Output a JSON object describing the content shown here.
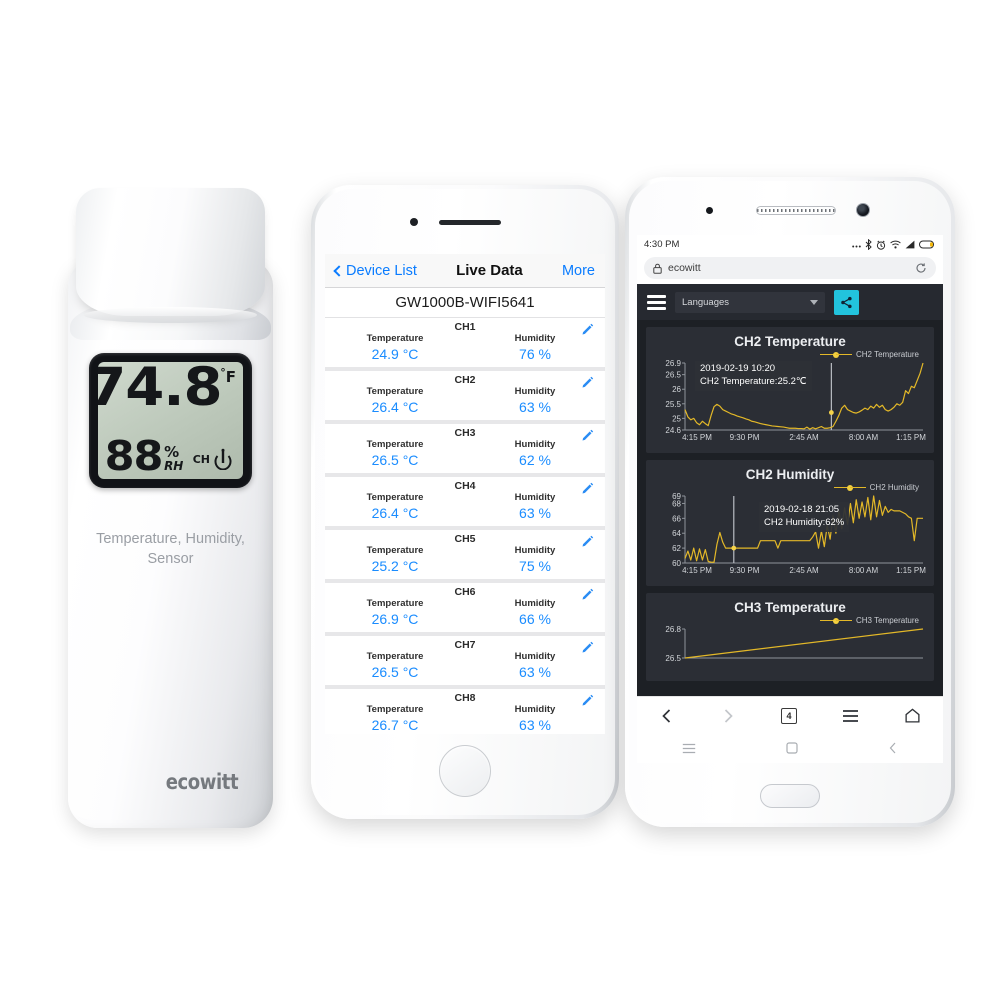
{
  "scene": {
    "background": "#ffffff"
  },
  "sensor": {
    "name": "ecowitt-temperature-humidity-sensor",
    "brand": "ecowitt",
    "label_line1": "Temperature, Humidity,",
    "label_line2": "Sensor",
    "lcd": {
      "temperature": "74.8",
      "temperature_unit": "°F",
      "temperature_unit_sup": "°",
      "temperature_unit_letter": "F",
      "humidity": "88",
      "humidity_percent": "%",
      "humidity_rh": "RH",
      "channel_label": "CH",
      "background": "#bcc8ba"
    }
  },
  "iphone": {
    "nav": {
      "back_label": "Device List",
      "title": "Live Data",
      "more_label": "More"
    },
    "device_name": "GW1000B-WIFI5641",
    "labels": {
      "temperature": "Temperature",
      "humidity": "Humidity"
    },
    "accent_color": "#1a8cff",
    "channels": [
      {
        "name": "CH1",
        "temperature": "24.9 °C",
        "humidity": "76 %"
      },
      {
        "name": "CH2",
        "temperature": "26.4 °C",
        "humidity": "63 %"
      },
      {
        "name": "CH3",
        "temperature": "26.5 °C",
        "humidity": "62 %"
      },
      {
        "name": "CH4",
        "temperature": "26.4 °C",
        "humidity": "63 %"
      },
      {
        "name": "CH5",
        "temperature": "25.2 °C",
        "humidity": "75 %"
      },
      {
        "name": "CH6",
        "temperature": "26.9 °C",
        "humidity": "66 %"
      },
      {
        "name": "CH7",
        "temperature": "26.5 °C",
        "humidity": "63 %"
      },
      {
        "name": "CH8",
        "temperature": "26.7 °C",
        "humidity": "63 %"
      }
    ]
  },
  "android": {
    "statusbar": {
      "time": "4:30 PM"
    },
    "browser": {
      "url": "ecowitt",
      "tab_count": "4"
    },
    "web_toolbar": {
      "language_label": "Languages",
      "share_color": "#22c3dd"
    },
    "theme": {
      "page_bg": "#1d2025",
      "panel_bg": "#2b2e35",
      "line_color": "#e3b828"
    },
    "charts": [
      {
        "title": "CH2 Temperature",
        "legend": "CH2 Temperature",
        "tooltip_line1": "2019-02-19 10:20",
        "tooltip_line2": "CH2 Temperature:25.2℃"
      },
      {
        "title": "CH2 Humidity",
        "legend": "CH2 Humidity",
        "tooltip_line1": "2019-02-18 21:05",
        "tooltip_line2": "CH2 Humidity:62%"
      },
      {
        "title": "CH3 Temperature",
        "legend": "CH3 Temperature"
      }
    ]
  },
  "chart_data": [
    {
      "type": "line",
      "title": "CH2 Temperature",
      "series": [
        {
          "name": "CH2 Temperature",
          "color": "#e3b828",
          "values": [
            25.3,
            25.05,
            24.95,
            25.0,
            24.85,
            24.78,
            24.9,
            24.82,
            24.75,
            25.1,
            25.4,
            25.48,
            25.42,
            25.3,
            25.25,
            25.2,
            25.15,
            25.12,
            25.08,
            25.05,
            25.02,
            24.98,
            24.95,
            24.9,
            24.88,
            24.85,
            24.82,
            24.8,
            24.78,
            24.76,
            24.74,
            24.73,
            24.72,
            24.71,
            24.7,
            24.68,
            24.66,
            24.66,
            24.66,
            24.65,
            24.65,
            24.64,
            24.7,
            24.63,
            24.68,
            24.64,
            24.68,
            24.72,
            24.66,
            24.66,
            24.68,
            24.72,
            24.9,
            25.1,
            25.35,
            25.45,
            25.3,
            25.25,
            25.2,
            25.18,
            25.22,
            25.28,
            25.35,
            25.3,
            25.42,
            25.35,
            25.48,
            25.38,
            25.45,
            25.3,
            25.25,
            25.3,
            25.38,
            25.5,
            25.45,
            25.55,
            25.95,
            25.85,
            26.1,
            26.05,
            26.3,
            26.55,
            26.9
          ]
        }
      ],
      "xlabel": "",
      "ylabel": "",
      "xticks": [
        "4:15 PM",
        "9:30 PM",
        "2:45 AM",
        "8:00 AM",
        "1:15 PM"
      ],
      "yticks": [
        "24.6",
        "25",
        "25.5",
        "26",
        "26.5",
        "26.9"
      ],
      "ylim": [
        24.6,
        26.9
      ],
      "grid": false,
      "legend_position": "top-right",
      "marker": {
        "x_fraction": 0.615,
        "value": 25.2,
        "label": "2019-02-19 10:20"
      },
      "annotation": "2019-02-19 10:20 / CH2 Temperature:25.2℃"
    },
    {
      "type": "line",
      "title": "CH2 Humidity",
      "series": [
        {
          "name": "CH2 Humidity",
          "color": "#e3b828",
          "values": [
            60.6,
            61.6,
            60.4,
            62.0,
            60.3,
            61.9,
            60.4,
            61.8,
            60.2,
            60.1,
            60.1,
            62.5,
            64.1,
            62.8,
            62.0,
            62.0,
            62.0,
            62.0,
            62.0,
            62.0,
            62.0,
            62.0,
            62.0,
            62.0,
            62.0,
            62.0,
            63.0,
            63.0,
            63.0,
            63.0,
            63.0,
            63.0,
            62.0,
            63.0,
            63.0,
            63.0,
            63.0,
            63.0,
            63.0,
            63.0,
            63.0,
            63.0,
            63.0,
            63.0,
            63.5,
            64.2,
            62.0,
            64.3,
            62.2,
            65.0,
            63.2,
            66.4,
            64.0,
            67.0,
            64.6,
            67.4,
            65.2,
            68.0,
            65.4,
            68.5,
            66.0,
            68.2,
            66.2,
            68.8,
            65.8,
            69.0,
            66.2,
            68.4,
            66.4,
            67.6,
            66.8,
            67.2,
            67.0,
            67.0,
            67.0,
            66.8,
            66.6,
            66.2,
            66.0,
            63.0,
            66.0,
            66.0,
            66.0
          ]
        }
      ],
      "xlabel": "",
      "ylabel": "",
      "xticks": [
        "4:15 PM",
        "9:30 PM",
        "2:45 AM",
        "8:00 AM",
        "1:15 PM"
      ],
      "yticks": [
        "60",
        "62",
        "64",
        "66",
        "68",
        "69"
      ],
      "ylim": [
        60,
        69
      ],
      "grid": false,
      "legend_position": "top-right",
      "marker": {
        "x_fraction": 0.205,
        "value": 62,
        "label": "2019-02-18 21:05"
      },
      "annotation": "2019-02-18 21:05 / CH2 Humidity:62%"
    },
    {
      "type": "line",
      "title": "CH3 Temperature",
      "series": [
        {
          "name": "CH3 Temperature",
          "color": "#e3b828",
          "values": [
            26.5,
            26.8
          ]
        }
      ],
      "xticks": [],
      "yticks": [
        "26.8",
        "26.5"
      ],
      "ylim": [
        26.5,
        26.8
      ],
      "grid": false,
      "legend_position": "top-right",
      "note": "partially visible, cut off by browser navigation bar"
    }
  ]
}
